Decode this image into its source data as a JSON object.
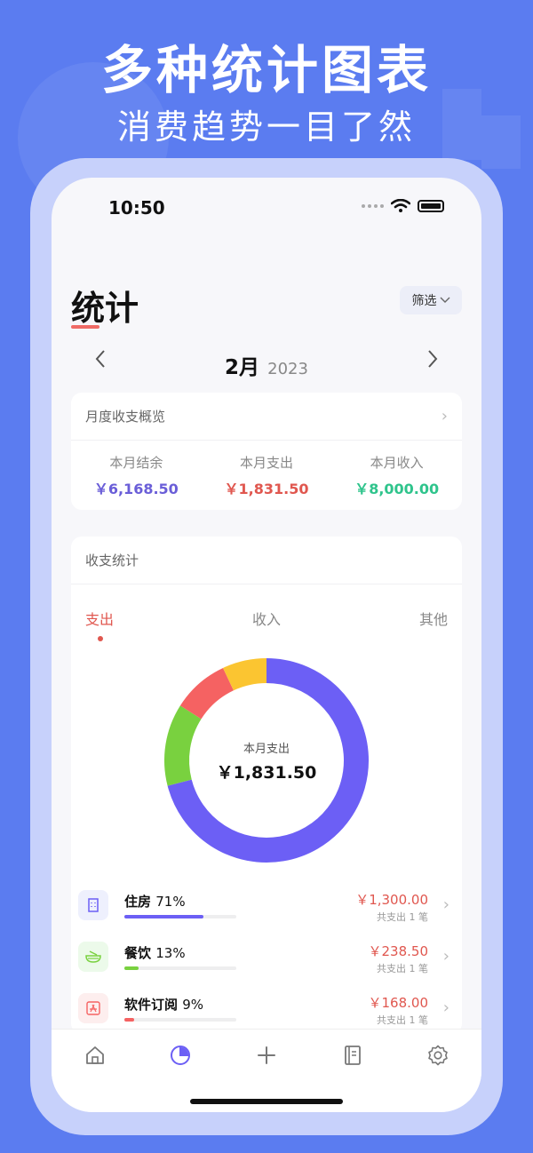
{
  "hero": {
    "title": "多种统计图表",
    "subtitle": "消费趋势一目了然"
  },
  "status_bar": {
    "time": "10:50"
  },
  "page": {
    "title": "统计",
    "filter_label": "筛选"
  },
  "month_nav": {
    "month": "2月",
    "year": "2023"
  },
  "overview": {
    "title": "月度收支概览",
    "items": [
      {
        "label": "本月结余",
        "value": "￥6,168.50",
        "color": "#6a5ed8"
      },
      {
        "label": "本月支出",
        "value": "￥1,831.50",
        "color": "#e0574f"
      },
      {
        "label": "本月收入",
        "value": "￥8,000.00",
        "color": "#2fc48c"
      }
    ]
  },
  "stats": {
    "title": "收支统计",
    "tabs": [
      {
        "label": "支出"
      },
      {
        "label": "收入"
      },
      {
        "label": "其他"
      }
    ],
    "active_tab": "支出",
    "center_label": "本月支出",
    "center_value": "￥1,831.50",
    "donut": [
      {
        "name": "住房",
        "value": 71,
        "color": "#6c5ff5"
      },
      {
        "name": "餐饮",
        "value": 13,
        "color": "#79d13f"
      },
      {
        "name": "软件订阅",
        "value": 9,
        "color": "#f56262"
      },
      {
        "name": "other",
        "value": 7,
        "color": "#fbc531"
      }
    ],
    "categories": [
      {
        "name": "住房",
        "pct": "71%",
        "bar": 0.71,
        "color": "#6c5ff5",
        "icon": "building-icon",
        "icon_bg": "#eef0fd",
        "amount": "￥1,300.00",
        "count": "共支出 1 笔"
      },
      {
        "name": "餐饮",
        "pct": "13%",
        "bar": 0.13,
        "color": "#79d13f",
        "icon": "noodle-bowl-icon",
        "icon_bg": "#ecfaea",
        "amount": "￥238.50",
        "count": "共支出 1 笔"
      },
      {
        "name": "软件订阅",
        "pct": "9%",
        "bar": 0.09,
        "color": "#f56262",
        "icon": "app-store-icon",
        "icon_bg": "#fdeeee",
        "amount": "￥168.00",
        "count": "共支出 1 笔"
      }
    ]
  },
  "tab_bar": {
    "items": [
      {
        "name": "home-icon"
      },
      {
        "name": "stats-icon",
        "active": true
      },
      {
        "name": "plus-icon"
      },
      {
        "name": "book-icon"
      },
      {
        "name": "gear-icon"
      }
    ]
  },
  "colors": {
    "background": "#5b7cf0",
    "accent": "#6c5ff5",
    "expense": "#e0574f",
    "income": "#2fc48c"
  }
}
